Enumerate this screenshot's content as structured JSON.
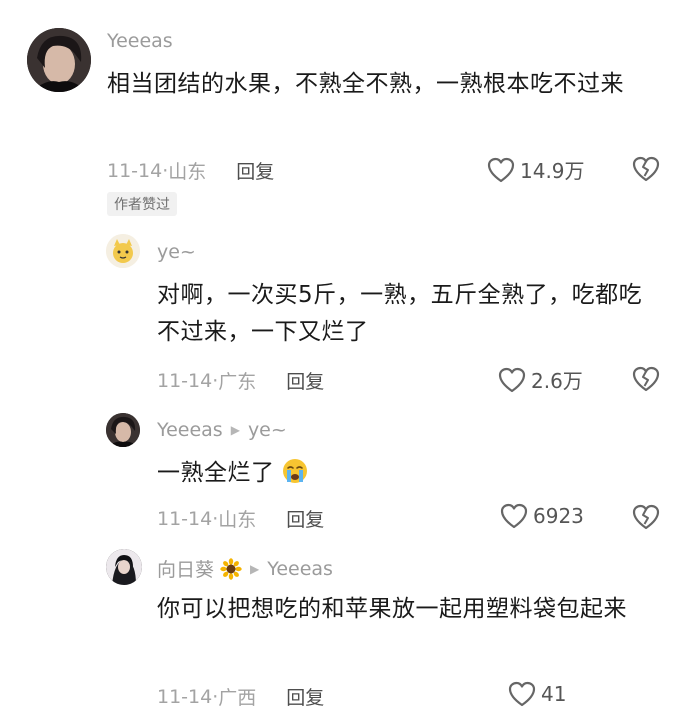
{
  "comments": [
    {
      "user": "Yeeeas",
      "text": "相当团结的水果，不熟全不熟，一熟根本吃不过来",
      "date": "11-14",
      "location": "山东",
      "reply_label": "回复",
      "likes": "14.9万",
      "badge": "作者赞过"
    },
    {
      "user": "ye~",
      "text": "对啊，一次买5斤，一熟，五斤全熟了，吃都吃不过来，一下又烂了",
      "date": "11-14",
      "location": "广东",
      "reply_label": "回复",
      "likes": "2.6万"
    },
    {
      "user": "Yeeeas",
      "reply_to": "ye~",
      "text": "一熟全烂了",
      "date": "11-14",
      "location": "山东",
      "reply_label": "回复",
      "likes": "6923"
    },
    {
      "user": "向日葵",
      "reply_to": "Yeeeas",
      "text": "你可以把想吃的和苹果放一起用塑料袋包起来",
      "date": "11-14",
      "location": "广西",
      "reply_label": "回复",
      "likes": "41"
    }
  ],
  "icons": {
    "like": "heart-outline-icon",
    "dislike": "broken-heart-icon",
    "reply_arrow": "triangle-right-icon",
    "emoji": "crying-face-icon",
    "flower": "sunflower-icon"
  },
  "colors": {
    "name": "#9b9b9b",
    "text": "#1a1a1a",
    "meta": "#a3a3a3",
    "icon": "#666666"
  }
}
